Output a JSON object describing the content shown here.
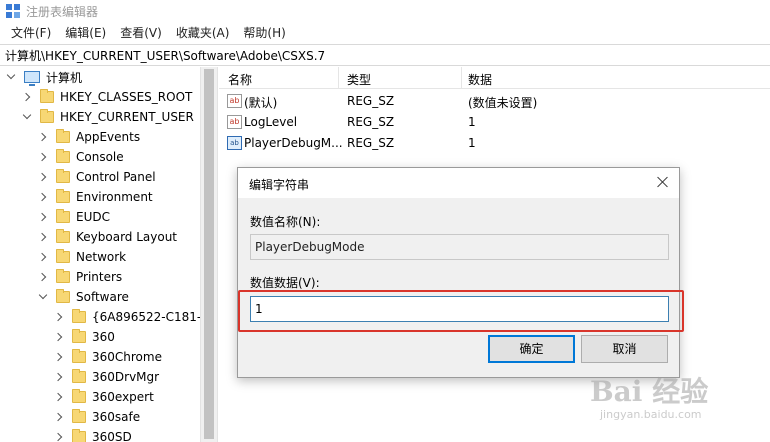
{
  "window": {
    "title": "注册表编辑器"
  },
  "menu": [
    "文件(F)",
    "编辑(E)",
    "查看(V)",
    "收藏夹(A)",
    "帮助(H)"
  ],
  "address": "计算机\\HKEY_CURRENT_USER\\Software\\Adobe\\CSXS.7",
  "tree": [
    {
      "label": "计算机",
      "expanded": true,
      "icon": "computer-icon"
    },
    {
      "label": "HKEY_CLASSES_ROOT",
      "expanded": false,
      "icon": "folder-icon"
    },
    {
      "label": "HKEY_CURRENT_USER",
      "expanded": true,
      "icon": "folder-icon"
    },
    {
      "label": "AppEvents",
      "expanded": false,
      "icon": "folder-icon"
    },
    {
      "label": "Console",
      "expanded": false,
      "icon": "folder-icon"
    },
    {
      "label": "Control Panel",
      "expanded": false,
      "icon": "folder-icon"
    },
    {
      "label": "Environment",
      "expanded": false,
      "icon": "folder-icon"
    },
    {
      "label": "EUDC",
      "expanded": false,
      "icon": "folder-icon"
    },
    {
      "label": "Keyboard Layout",
      "expanded": false,
      "icon": "folder-icon"
    },
    {
      "label": "Network",
      "expanded": false,
      "icon": "folder-icon"
    },
    {
      "label": "Printers",
      "expanded": false,
      "icon": "folder-icon"
    },
    {
      "label": "Software",
      "expanded": true,
      "icon": "folder-icon"
    },
    {
      "label": "{6A896522-C181-4",
      "expanded": false,
      "icon": "folder-icon"
    },
    {
      "label": "360",
      "expanded": false,
      "icon": "folder-icon"
    },
    {
      "label": "360Chrome",
      "expanded": false,
      "icon": "folder-icon"
    },
    {
      "label": "360DrvMgr",
      "expanded": false,
      "icon": "folder-icon"
    },
    {
      "label": "360expert",
      "expanded": false,
      "icon": "folder-icon"
    },
    {
      "label": "360safe",
      "expanded": false,
      "icon": "folder-icon"
    },
    {
      "label": "360SD",
      "expanded": false,
      "icon": "folder-icon"
    }
  ],
  "list": {
    "columns": [
      "名称",
      "类型",
      "数据"
    ],
    "rows": [
      {
        "name": "(默认)",
        "type": "REG_SZ",
        "data": "(数值未设置)",
        "icon": "string-value-icon"
      },
      {
        "name": "LogLevel",
        "type": "REG_SZ",
        "data": "1",
        "icon": "string-value-icon"
      },
      {
        "name": "PlayerDebugM...",
        "type": "REG_SZ",
        "data": "1",
        "icon": "binary-value-icon"
      }
    ]
  },
  "dialog": {
    "title": "编辑字符串",
    "name_label": "数值名称(N):",
    "name_value": "PlayerDebugMode",
    "data_label": "数值数据(V):",
    "data_value": "1",
    "ok_label": "确定",
    "cancel_label": "取消"
  },
  "watermark": {
    "main": "Bai 经验",
    "sub": "jingyan.baidu.com"
  },
  "colors": {
    "highlight": "#d9352b",
    "accent": "#0078d7",
    "folder": "#f7d774"
  }
}
